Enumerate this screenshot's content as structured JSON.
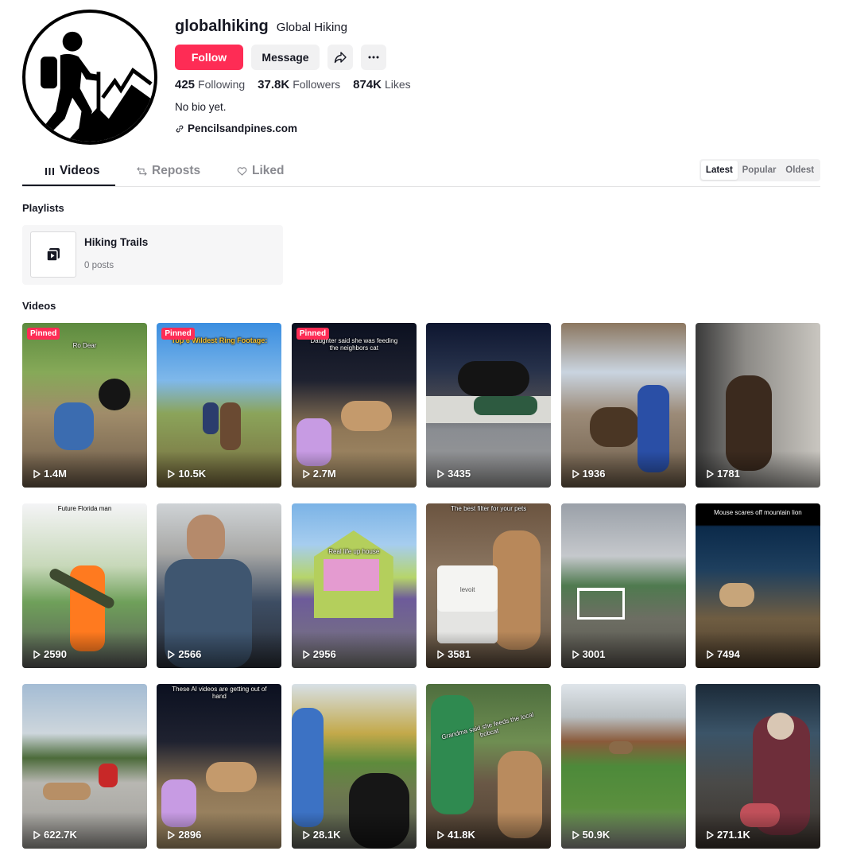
{
  "profile": {
    "username": "globalhiking",
    "nickname": "Global Hiking",
    "follow_label": "Follow",
    "message_label": "Message",
    "stats": {
      "following_count": "425",
      "following_label": "Following",
      "followers_count": "37.8K",
      "followers_label": "Followers",
      "likes_count": "874K",
      "likes_label": "Likes"
    },
    "bio": "No bio yet.",
    "link": "Pencilsandpines.com"
  },
  "tabs": {
    "videos": "Videos",
    "reposts": "Reposts",
    "liked": "Liked"
  },
  "sort": {
    "latest": "Latest",
    "popular": "Popular",
    "oldest": "Oldest"
  },
  "playlists": {
    "title": "Playlists",
    "items": [
      {
        "name": "Hiking Trails",
        "count": "0 posts"
      }
    ]
  },
  "videos_title": "Videos",
  "pinned_label": "Pinned",
  "videos": [
    {
      "views": "1.4M",
      "pinned": true,
      "caption": "Ro Dear"
    },
    {
      "views": "10.5K",
      "pinned": true,
      "caption": "Top 6 Wildest Ring Footage:"
    },
    {
      "views": "2.7M",
      "pinned": true,
      "caption": "Daughter said she was feeding the neighbors cat"
    },
    {
      "views": "3435",
      "pinned": false,
      "caption": ""
    },
    {
      "views": "1936",
      "pinned": false,
      "caption": ""
    },
    {
      "views": "1781",
      "pinned": false,
      "caption": ""
    },
    {
      "views": "2590",
      "pinned": false,
      "caption": "Future Florida man"
    },
    {
      "views": "2566",
      "pinned": false,
      "caption": ""
    },
    {
      "views": "2956",
      "pinned": false,
      "caption": "Real life up house"
    },
    {
      "views": "3581",
      "pinned": false,
      "caption": "The best filter for your pets",
      "brand": "levoit"
    },
    {
      "views": "3001",
      "pinned": false,
      "caption": ""
    },
    {
      "views": "7494",
      "pinned": false,
      "caption": "Mouse scares off mountain lion"
    },
    {
      "views": "622.7K",
      "pinned": false,
      "caption": ""
    },
    {
      "views": "2896",
      "pinned": false,
      "caption": "These AI videos are getting out of hand"
    },
    {
      "views": "28.1K",
      "pinned": false,
      "caption": ""
    },
    {
      "views": "41.8K",
      "pinned": false,
      "caption": "Grandma said she feeds the local bobcat"
    },
    {
      "views": "50.9K",
      "pinned": false,
      "caption": ""
    },
    {
      "views": "271.1K",
      "pinned": false,
      "caption": ""
    }
  ],
  "colors": {
    "accent": "#fe2c55",
    "text": "#161823",
    "muted": "#8a8b91"
  }
}
